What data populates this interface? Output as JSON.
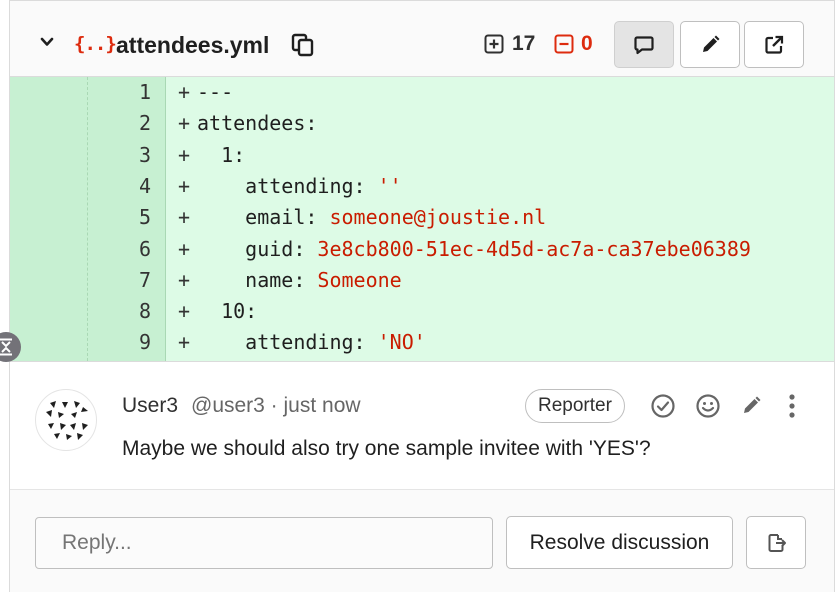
{
  "file": {
    "name": "attendees.yml",
    "type_icon": "{..}",
    "added_count": "17",
    "removed_count": "0"
  },
  "icons": {
    "collapse": "chevron-down-icon",
    "copy": "copy-icon",
    "comments": "comment-icon",
    "edit": "pencil-icon",
    "external": "external-link-icon",
    "expand": "expand-icon",
    "resolve": "check-circle-icon",
    "emoji": "smiley-icon",
    "more": "ellipsis-v-icon",
    "new_issue": "issue-new-icon"
  },
  "colors": {
    "added_bg": "#ddfbe6",
    "added_gutter": "#c7f0d2",
    "string_value": "#c91c00",
    "removed_count": "#dd2b0e"
  },
  "diff": {
    "lines": [
      {
        "num": "1",
        "marker": "+",
        "key": "---",
        "value": ""
      },
      {
        "num": "2",
        "marker": "+",
        "key": "attendees:",
        "value": ""
      },
      {
        "num": "3",
        "marker": "+",
        "key": "  1:",
        "value": ""
      },
      {
        "num": "4",
        "marker": "+",
        "key": "    attending: ",
        "value": "''"
      },
      {
        "num": "5",
        "marker": "+",
        "key": "    email: ",
        "value": "someone@joustie.nl"
      },
      {
        "num": "6",
        "marker": "+",
        "key": "    guid: ",
        "value": "3e8cb800-51ec-4d5d-ac7a-ca37ebe06389"
      },
      {
        "num": "7",
        "marker": "+",
        "key": "    name: ",
        "value": "Someone"
      },
      {
        "num": "8",
        "marker": "+",
        "key": "  10:",
        "value": ""
      },
      {
        "num": "9",
        "marker": "+",
        "key": "    attending: ",
        "value": "'NO'"
      }
    ]
  },
  "note": {
    "author": "User3",
    "meta": "@user3 · just now",
    "role": "Reporter",
    "body": "Maybe we should also try one sample invitee with 'YES'?"
  },
  "reply": {
    "placeholder": "Reply...",
    "resolve_label": "Resolve discussion"
  }
}
